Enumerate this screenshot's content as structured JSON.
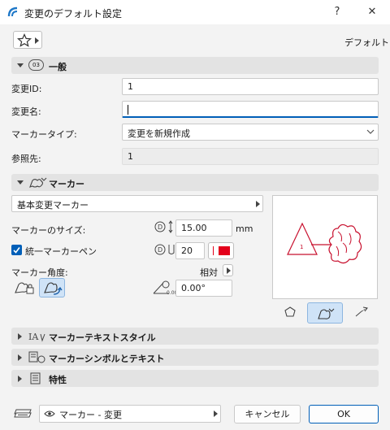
{
  "window": {
    "title": "変更のデフォルト設定",
    "help": "?",
    "close": "✕"
  },
  "header": {
    "right_label": "デフォルト"
  },
  "general": {
    "title": "一般",
    "badge": "03",
    "id_label": "変更ID:",
    "id_value": "1",
    "name_label": "変更名:",
    "name_value": "",
    "marker_type_label": "マーカータイプ:",
    "marker_type_value": "変更を新規作成",
    "ref_label": "参照先:",
    "ref_value": "1"
  },
  "marker": {
    "title": "マーカー",
    "dropdown_value": "基本変更マーカー",
    "size_label": "マーカーのサイズ:",
    "size_value": "15.00",
    "size_unit": "mm",
    "pen_label": "統一マーカーペン",
    "pen_value": "20",
    "pen_color": "#e3001b",
    "angle_label": "マーカー角度:",
    "angle_mode": "相対",
    "angle_value": "0.00°",
    "preview_number": "1"
  },
  "sections": [
    {
      "label": "マーカーテキストスタイル"
    },
    {
      "label": "マーカーシンボルとテキスト"
    },
    {
      "label": "特性"
    }
  ],
  "footer": {
    "layer_value": "マーカー - 変更",
    "cancel": "キャンセル",
    "ok": "OK"
  },
  "colors": {
    "accent": "#005fb8",
    "marker_red": "#d01020"
  }
}
